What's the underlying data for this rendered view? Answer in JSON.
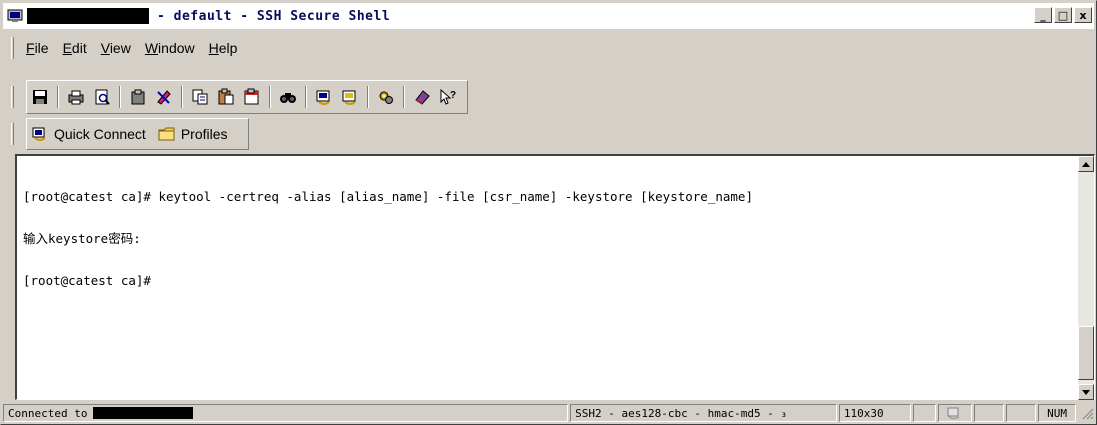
{
  "window": {
    "title": "- default - SSH Secure Shell",
    "controls": {
      "minimize": "_",
      "maximize": "□",
      "close": "x"
    }
  },
  "menu": {
    "items": [
      {
        "first": "F",
        "rest": "ile"
      },
      {
        "first": "E",
        "rest": "dit"
      },
      {
        "first": "V",
        "rest": "iew"
      },
      {
        "first": "W",
        "rest": "indow"
      },
      {
        "first": "H",
        "rest": "elp"
      }
    ]
  },
  "toolbar": {
    "icons": [
      "save-icon",
      "print-icon",
      "print-preview-icon",
      "paste-icon",
      "terminal-settings-icon",
      "copy-icon",
      "paste-clipboard-icon",
      "clipboard-icon",
      "find-icon",
      "connect-icon",
      "disconnect-icon",
      "settings-icon",
      "help-icon",
      "context-help-icon"
    ]
  },
  "quickbar": {
    "quick_connect": "Quick Connect",
    "profiles": "Profiles"
  },
  "terminal": {
    "lines": [
      "[root@catest ca]# keytool -certreq -alias [alias_name] -file [csr_name] -keystore [keystore_name]",
      "输入keystore密码:",
      "[root@catest ca]#"
    ]
  },
  "status": {
    "connected": "Connected to",
    "cipher": "SSH2 - aes128-cbc - hmac-md5 - ₃",
    "size": "110x30",
    "num": "NUM"
  },
  "colors": {
    "window_face": "#d4d0c8",
    "title_text": "#0a0a5c",
    "terminal_bg": "#ffffff"
  }
}
